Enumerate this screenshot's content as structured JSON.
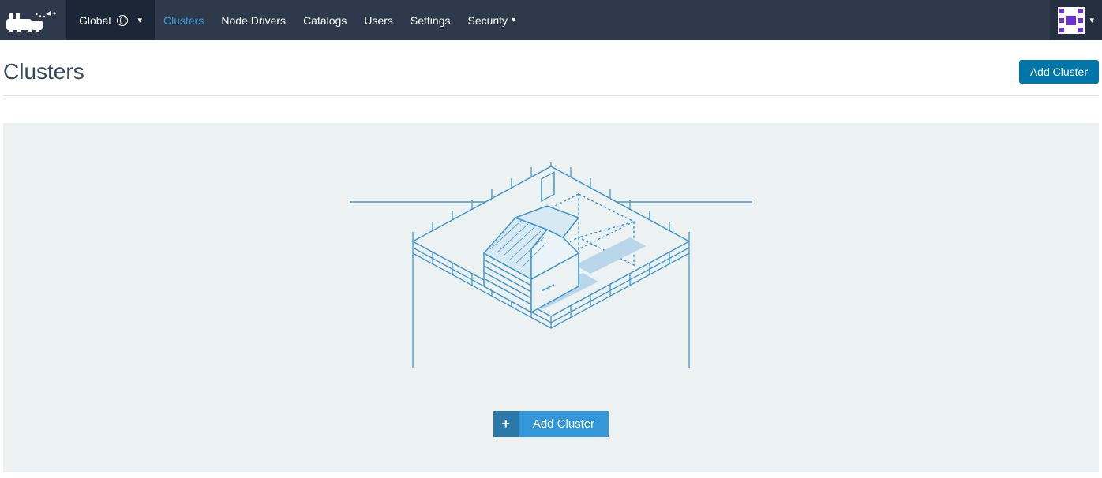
{
  "scope": {
    "label": "Global"
  },
  "nav": {
    "items": [
      {
        "label": "Clusters",
        "active": true,
        "dropdown": false
      },
      {
        "label": "Node Drivers",
        "active": false,
        "dropdown": false
      },
      {
        "label": "Catalogs",
        "active": false,
        "dropdown": false
      },
      {
        "label": "Users",
        "active": false,
        "dropdown": false
      },
      {
        "label": "Settings",
        "active": false,
        "dropdown": false
      },
      {
        "label": "Security",
        "active": false,
        "dropdown": true
      }
    ]
  },
  "page": {
    "title": "Clusters",
    "add_button": "Add Cluster"
  },
  "empty": {
    "add_button": "Add Cluster"
  }
}
